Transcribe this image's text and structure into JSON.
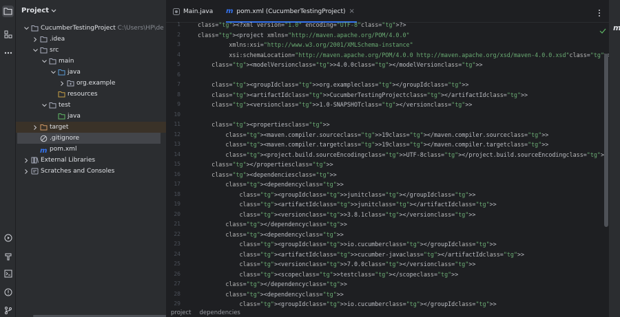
{
  "project_panel": {
    "title": "Project",
    "tree": [
      {
        "label": "CucumberTestingProject",
        "path": "C:\\Users\\HP\\de",
        "depth": 0,
        "expanded": true,
        "icon": "folder-icon"
      },
      {
        "label": ".idea",
        "depth": 1,
        "expanded": false,
        "icon": "folder-icon"
      },
      {
        "label": "src",
        "depth": 1,
        "expanded": true,
        "icon": "folder-icon"
      },
      {
        "label": "main",
        "depth": 2,
        "expanded": true,
        "icon": "folder-icon"
      },
      {
        "label": "java",
        "depth": 3,
        "expanded": true,
        "icon": "source-folder-icon"
      },
      {
        "label": "org.example",
        "depth": 4,
        "expanded": false,
        "icon": "package-icon"
      },
      {
        "label": "resources",
        "depth": 3,
        "icon": "resources-folder-icon"
      },
      {
        "label": "test",
        "depth": 2,
        "expanded": true,
        "icon": "folder-icon"
      },
      {
        "label": "java",
        "depth": 3,
        "icon": "test-folder-icon"
      },
      {
        "label": "target",
        "depth": 1,
        "expanded": false,
        "icon": "excluded-folder-icon"
      },
      {
        "label": ".gitignore",
        "depth": 1,
        "icon": "gitignore-icon"
      },
      {
        "label": "pom.xml",
        "depth": 1,
        "icon": "maven-icon"
      },
      {
        "label": "External Libraries",
        "depth": 0,
        "expanded": false,
        "icon": "library-icon"
      },
      {
        "label": "Scratches and Consoles",
        "depth": 0,
        "expanded": false,
        "icon": "scratches-icon"
      }
    ]
  },
  "tabs": [
    {
      "label": "Main.java",
      "icon": "java-file-icon",
      "active": false
    },
    {
      "label": "pom.xml (CucumberTestingProject)",
      "icon": "maven-icon",
      "active": true,
      "close": "×"
    }
  ],
  "code_lines": [
    "<?xml version=\"1.0\" encoding=\"UTF-8\"?>",
    "<project xmlns=\"http://maven.apache.org/POM/4.0.0\"",
    "         xmlns:xsi=\"http://www.w3.org/2001/XMLSchema-instance\"",
    "         xsi:schemaLocation=\"http://maven.apache.org/POM/4.0.0 http://maven.apache.org/xsd/maven-4.0.0.xsd\">",
    "    <modelVersion>4.0.0</modelVersion>",
    "",
    "    <groupId>org.example</groupId>",
    "    <artifactId>CucumberTestingProject</artifactId>",
    "    <version>1.0-SNAPSHOT</version>",
    "",
    "    <properties>",
    "        <maven.compiler.source>19</maven.compiler.source>",
    "        <maven.compiler.target>19</maven.compiler.target>",
    "        <project.build.sourceEncoding>UTF-8</project.build.sourceEncoding>",
    "    </properties>",
    "    <dependencies>",
    "        <dependency>",
    "            <groupId>junit</groupId>",
    "            <artifactId>junit</artifactId>",
    "            <version>3.8.1</version>",
    "        </dependency>",
    "        <dependency>",
    "            <groupId>io.cucumber</groupId>",
    "            <artifactId>cucumber-java</artifactId>",
    "            <version>7.0.0</version>",
    "            <scope>test</scope>",
    "        </dependency>",
    "        <dependency>",
    "            <groupId>io.cucumber</groupId>"
  ],
  "breadcrumb": [
    "project",
    "dependencies"
  ],
  "colors": {
    "accent": "#3574f0",
    "tag": "#d5b778",
    "attr_value": "#6aab73"
  }
}
